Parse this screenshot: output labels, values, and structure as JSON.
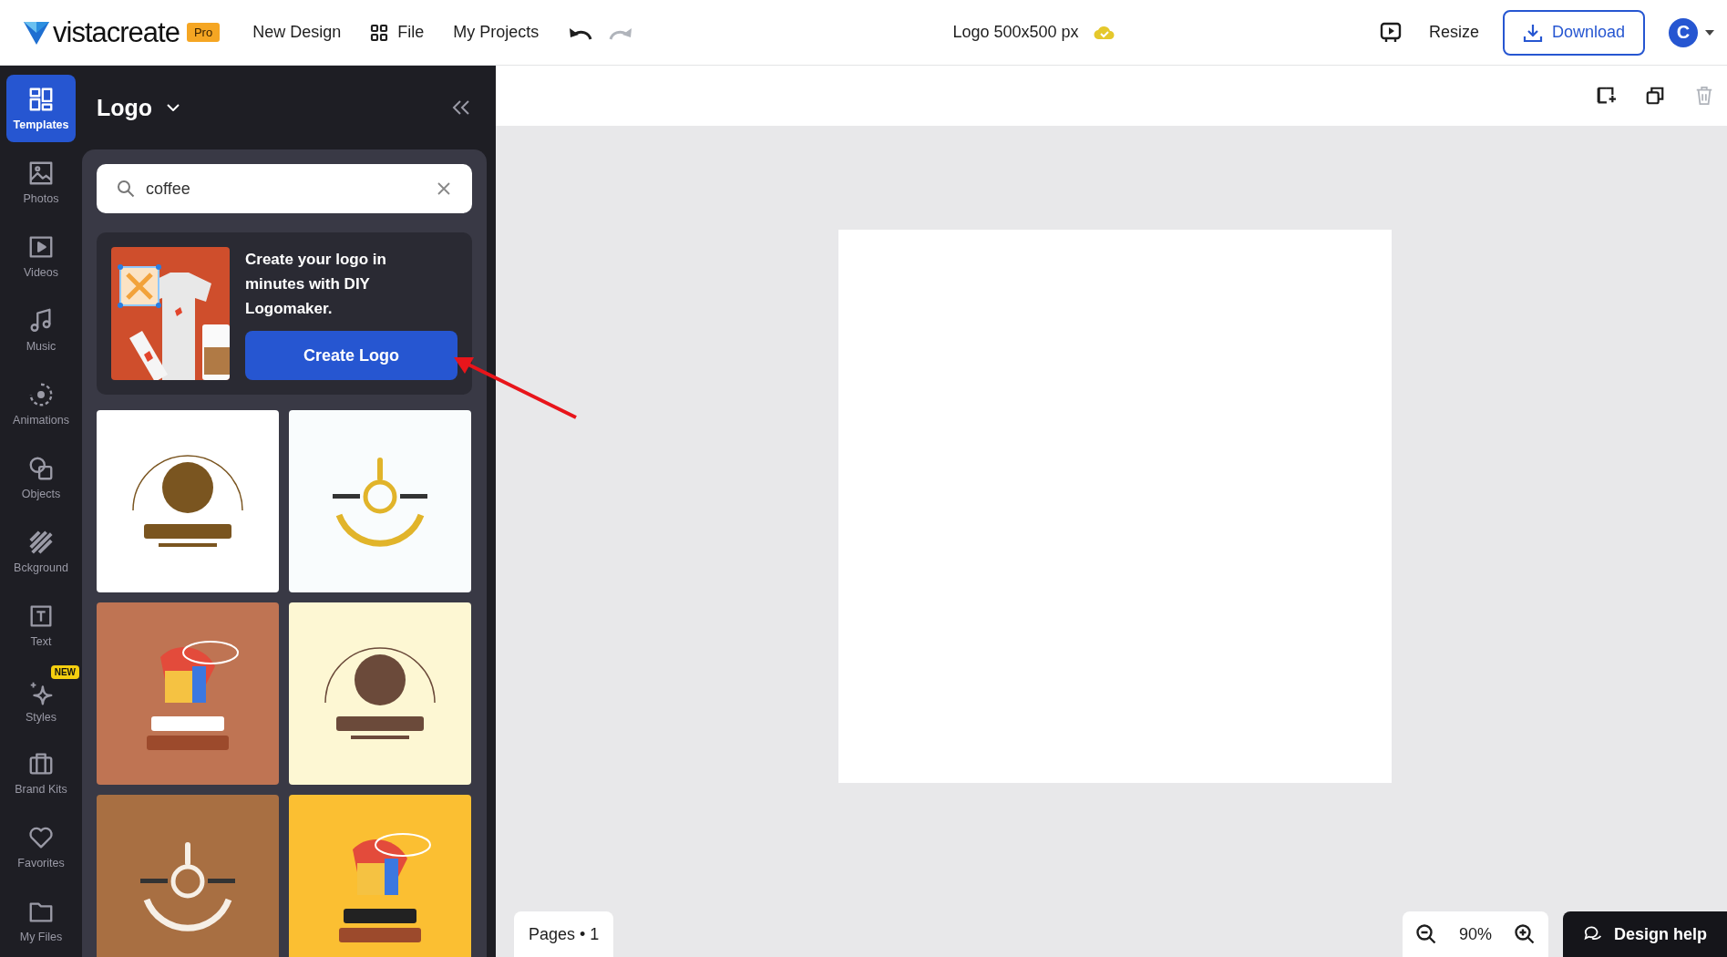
{
  "top_bar": {
    "logo": "vistacreate",
    "plan_badge": "Pro",
    "menu": [
      "New Design",
      "File",
      "My Projects"
    ],
    "document_title": "Logo 500x500 px",
    "resize": "Resize",
    "download": "Download",
    "avatar": "C"
  },
  "rail": [
    {
      "label": "Templates",
      "selected": true
    },
    {
      "label": "Photos",
      "selected": false
    },
    {
      "label": "Videos",
      "selected": false
    },
    {
      "label": "Music",
      "selected": false
    },
    {
      "label": "Animations",
      "selected": false
    },
    {
      "label": "Objects",
      "selected": false
    },
    {
      "label": "Bckground",
      "selected": false
    },
    {
      "label": "Text",
      "selected": false
    },
    {
      "label": "Styles",
      "selected": false,
      "badge": "NEW"
    },
    {
      "label": "Brand Kits",
      "selected": false
    },
    {
      "label": "Favorites",
      "selected": false
    },
    {
      "label": "My Files",
      "selected": false
    }
  ],
  "panel": {
    "title": "Logo",
    "search": {
      "value": "coffee"
    },
    "promo": {
      "text": "Create your logo in minutes with DIY Logomaker.",
      "button": "Create Logo"
    }
  },
  "bottom_bar": {
    "pages": "Pages • 1",
    "zoom": "90%",
    "help": "Design help"
  }
}
